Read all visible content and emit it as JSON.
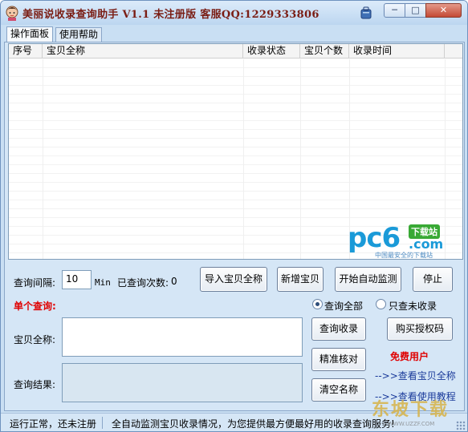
{
  "window": {
    "title": "美丽说收录查询助手 V1.1 未注册版  客服QQ:1229333806"
  },
  "tabs": [
    {
      "label": "操作面板",
      "active": true
    },
    {
      "label": "使用帮助",
      "active": false
    }
  ],
  "table": {
    "columns": [
      "序号",
      "宝贝全称",
      "收录状态",
      "宝贝个数",
      "收录时间"
    ],
    "rows": []
  },
  "watermark": {
    "brand": "pc6",
    "badge": "下载站",
    "domain": ".com",
    "tagline": "中国最安全的下载站"
  },
  "controls": {
    "interval_label": "查询间隔:",
    "interval_value": "10",
    "interval_unit": "Min",
    "query_count_label": "已查询次数:",
    "query_count_value": "0",
    "import_button": "导入宝贝全称",
    "add_button": "新增宝贝",
    "auto_monitor_button": "开始自动监测",
    "stop_button": "停止",
    "single_query_label": "单个查询:",
    "radio_all": "查询全部",
    "radio_unindexed": "只查未收录",
    "radio_selected": "all",
    "item_name_label": "宝贝全称:",
    "item_name_value": "",
    "query_button": "查询收录",
    "buy_button": "购买授权码",
    "result_label": "查询结果:",
    "result_value": "",
    "verify_button": "精准核对",
    "clear_button": "清空名称",
    "free_user": "免费用户",
    "view_items_link": "-->>查看宝贝全称",
    "view_tutorial_link": "-->>查看使用教程"
  },
  "statusbar": {
    "status": "运行正常，还未注册",
    "message": "全自动监测宝贝收录情况，为您提供最方便最好用的收录查询服务!"
  },
  "corner_watermark": {
    "text": "东坡下载",
    "domain": "WWW.UZZF.COM"
  },
  "colors": {
    "title_text": "#7a1d14",
    "window_bg": "#d5e6f6",
    "accent_red": "#e00000",
    "link_blue": "#1a3a9a"
  }
}
